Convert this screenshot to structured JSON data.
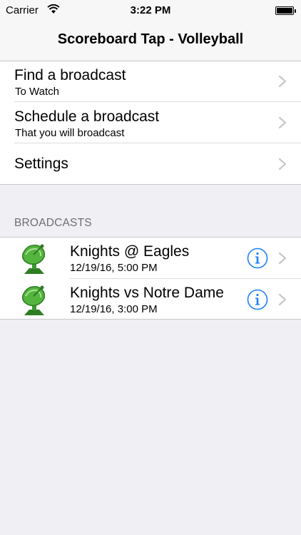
{
  "status_bar": {
    "carrier": "Carrier",
    "time": "3:22 PM",
    "battery_level": 1.0
  },
  "nav": {
    "title": "Scoreboard Tap - Volleyball"
  },
  "menu": {
    "items": [
      {
        "title": "Find a broadcast",
        "subtitle": "To Watch",
        "icon": "chevron-right-icon"
      },
      {
        "title": "Schedule a broadcast",
        "subtitle": "That you will broadcast",
        "icon": "chevron-right-icon"
      },
      {
        "title": "Settings",
        "subtitle": "",
        "icon": "chevron-right-icon"
      }
    ]
  },
  "broadcasts": {
    "header": "BROADCASTS",
    "items": [
      {
        "title": "Knights @ Eagles",
        "datetime": "12/19/16, 5:00 PM",
        "icon": "satellite-dish-icon"
      },
      {
        "title": "Knights vs Notre Dame",
        "datetime": "12/19/16, 3:00 PM",
        "icon": "satellite-dish-icon"
      }
    ]
  },
  "colors": {
    "tint": "#1a82fb",
    "dish_green": "#3a9a2e",
    "background": "#efeff4",
    "chevron": "#c7c7cc"
  }
}
